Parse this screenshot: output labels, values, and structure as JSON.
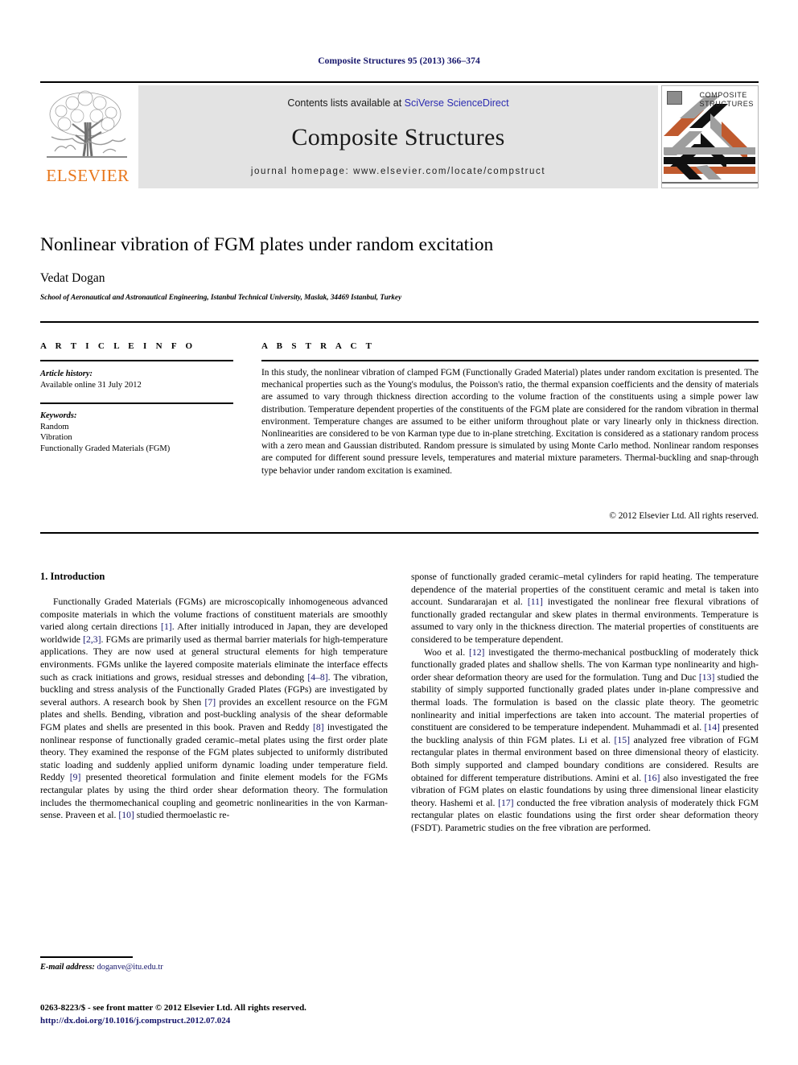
{
  "masthead": {
    "running_head": "Composite Structures 95 (2013) 366–374"
  },
  "banner": {
    "contents_prefix": "Contents lists available at ",
    "sciencedirect_link": "SciVerse ScienceDirect",
    "journal_title": "Composite Structures",
    "homepage_line": "journal homepage: www.elsevier.com/locate/compstruct",
    "publisher_name": "ELSEVIER",
    "cover_title_line1": "COMPOSITE",
    "cover_title_line2": "STRUCTURES",
    "accent_orange": "#e8761a",
    "link_blue": "#2b2bb0",
    "banner_grey": "#e3e3e3"
  },
  "article": {
    "title": "Nonlinear vibration of FGM plates under random excitation",
    "author": "Vedat Dogan",
    "affiliation": "School of Aeronautical and Astronautical Engineering, Istanbul Technical University, Maslak, 34469 Istanbul, Turkey"
  },
  "info": {
    "heading": "A R T I C L E   I N F O",
    "history_label": "Article history:",
    "history_value": "Available online 31 July 2012",
    "keywords_label": "Keywords:",
    "keywords": [
      "Random",
      "Vibration",
      "Functionally Graded Materials (FGM)"
    ]
  },
  "abstract": {
    "heading": "A B S T R A C T",
    "text": "In this study, the nonlinear vibration of clamped FGM (Functionally Graded Material) plates under random excitation is presented. The mechanical properties such as the Young's modulus, the Poisson's ratio, the thermal expansion coefficients and the density of materials are assumed to vary through thickness direction according to the volume fraction of the constituents using a simple power law distribution. Temperature dependent properties of the constituents of the FGM plate are considered for the random vibration in thermal environment. Temperature changes are assumed to be either uniform throughout plate or vary linearly only in thickness direction. Nonlinearities are considered to be von Karman type due to in-plane stretching. Excitation is considered as a stationary random process with a zero mean and Gaussian distributed. Random pressure is simulated by using Monte Carlo method. Nonlinear random responses are computed for different sound pressure levels, temperatures and material mixture parameters. Thermal-buckling and snap-through type behavior under random excitation is examined.",
    "copyright": "© 2012 Elsevier Ltd. All rights reserved."
  },
  "body": {
    "section_heading": "1. Introduction",
    "left_paragraphs": [
      "Functionally Graded Materials (FGMs) are microscopically inhomogeneous advanced composite materials in which the volume fractions of constituent materials are smoothly varied along certain directions [1]. After initially introduced in Japan, they are developed worldwide [2,3]. FGMs are primarily used as thermal barrier materials for high-temperature applications. They are now used at general structural elements for high temperature environments. FGMs unlike the layered composite materials eliminate the interface effects such as crack initiations and grows, residual stresses and debonding [4–8]. The vibration, buckling and stress analysis of the Functionally Graded Plates (FGPs) are investigated by several authors. A research book by Shen [7] provides an excellent resource on the FGM plates and shells. Bending, vibration and post-buckling analysis of the shear deformable FGM plates and shells are presented in this book. Praven and Reddy [8] investigated the nonlinear response of functionally graded ceramic–metal plates using the first order plate theory. They examined the response of the FGM plates subjected to uniformly distributed static loading and suddenly applied uniform dynamic loading under temperature field. Reddy [9] presented theoretical formulation and finite element models for the FGMs rectangular plates by using the third order shear deformation theory. The formulation includes the thermomechanical coupling and geometric nonlinearities in the von Karman-sense. Praveen et al. [10] studied thermoelastic re-"
    ],
    "right_paragraphs": [
      "sponse of functionally graded ceramic–metal cylinders for rapid heating. The temperature dependence of the material properties of the constituent ceramic and metal is taken into account. Sundararajan et al. [11] investigated the nonlinear free flexural vibrations of functionally graded rectangular and skew plates in thermal environments. Temperature is assumed to vary only in the thickness direction. The material properties of constituents are considered to be temperature dependent.",
      "Woo et al. [12] investigated the thermo-mechanical postbuckling of moderately thick functionally graded plates and shallow shells. The von Karman type nonlinearity and high-order shear deformation theory are used for the formulation. Tung and Duc [13] studied the stability of simply supported functionally graded plates under in-plane compressive and thermal loads. The formulation is based on the classic plate theory. The geometric nonlinearity and initial imperfections are taken into account. The material properties of constituent are considered to be temperature independent. Muhammadi et al. [14] presented the buckling analysis of thin FGM plates. Li et al. [15] analyzed free vibration of FGM rectangular plates in thermal environment based on three dimensional theory of elasticity. Both simply supported and clamped boundary conditions are considered. Results are obtained for different temperature distributions. Amini et al. [16] also investigated the free vibration of FGM plates on elastic foundations by using three dimensional linear elasticity theory. Hashemi et al. [17] conducted the free vibration analysis of moderately thick FGM rectangular plates on elastic foundations using the first order shear deformation theory (FSDT). Parametric studies on the free vibration are performed."
    ],
    "reference_color": "#15156b"
  },
  "footer": {
    "email_label": "E-mail address:",
    "email": "doganve@itu.edu.tr",
    "imprint_line": "0263-8223/$ - see front matter © 2012 Elsevier Ltd. All rights reserved.",
    "doi": "http://dx.doi.org/10.1016/j.compstruct.2012.07.024"
  }
}
